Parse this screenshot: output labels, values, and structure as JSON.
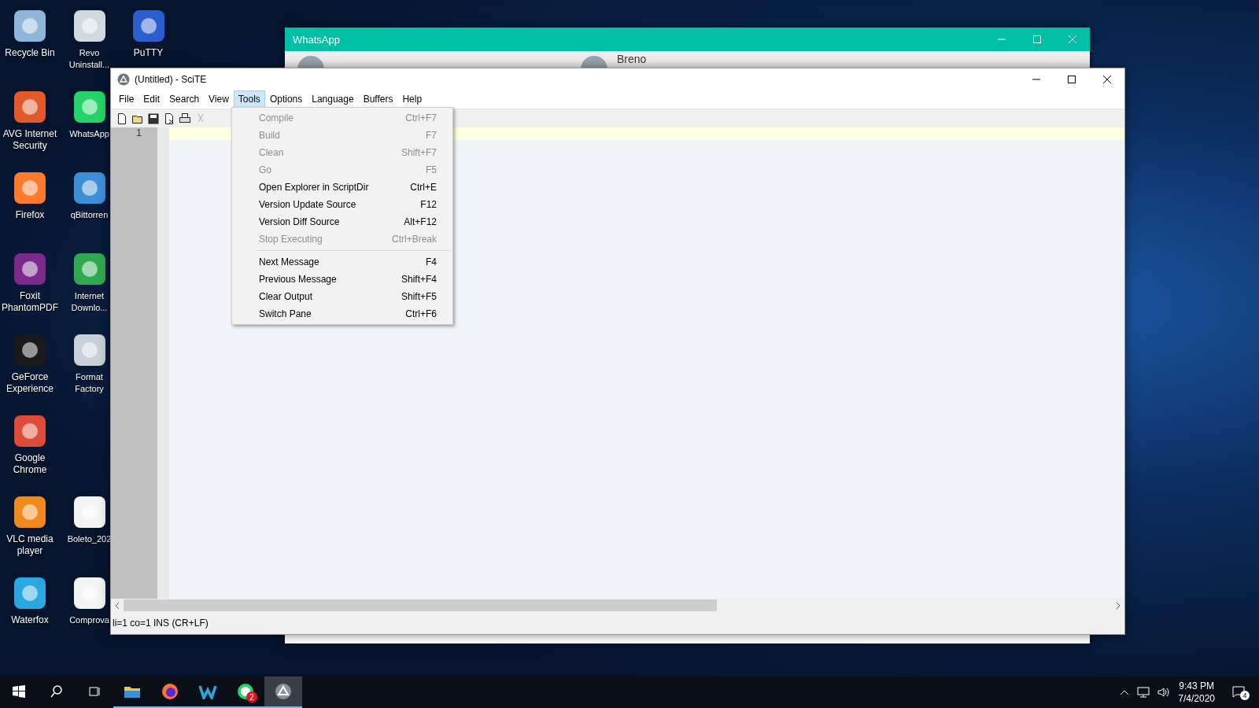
{
  "desktop": {
    "columns": [
      {
        "icons": [
          {
            "label": "Recycle Bin"
          },
          {
            "label": "AVG Internet Security"
          },
          {
            "label": "Firefox"
          },
          {
            "label": "Foxit PhantomPDF"
          },
          {
            "label": "GeForce Experience"
          },
          {
            "label": "Google Chrome"
          },
          {
            "label": "VLC media player"
          },
          {
            "label": "Waterfox"
          }
        ]
      },
      {
        "icons": [
          {
            "label": "Revo Uninstall..."
          },
          {
            "label": "WhatsApp"
          },
          {
            "label": "qBittorren"
          },
          {
            "label": "Internet Downlo..."
          },
          {
            "label": "Format Factory"
          },
          {
            "kind": "gap"
          },
          {
            "label": "Boleto_202"
          },
          {
            "label": "Comprova"
          }
        ]
      },
      {
        "icons": [
          {
            "label": "PuTTY"
          }
        ]
      }
    ]
  },
  "whatsapp": {
    "title": "WhatsApp",
    "contact": "Breno"
  },
  "scite": {
    "title": "(Untitled) - SciTE",
    "menu": [
      {
        "label": "File",
        "selected": false
      },
      {
        "label": "Edit",
        "selected": false
      },
      {
        "label": "Search",
        "selected": false
      },
      {
        "label": "View",
        "selected": false
      },
      {
        "label": "Tools",
        "selected": true
      },
      {
        "label": "Options",
        "selected": false
      },
      {
        "label": "Language",
        "selected": false
      },
      {
        "label": "Buffers",
        "selected": false
      },
      {
        "label": "Help",
        "selected": false
      }
    ],
    "line_numbers": [
      "1"
    ],
    "status": "li=1 co=1 INS (CR+LF)"
  },
  "tools_menu": {
    "sections": [
      {
        "items": [
          {
            "label": "Compile",
            "shortcut": "Ctrl+F7",
            "disabled": true
          },
          {
            "label": "Build",
            "shortcut": "F7",
            "disabled": true
          },
          {
            "label": "Clean",
            "shortcut": "Shift+F7",
            "disabled": true
          },
          {
            "label": "Go",
            "shortcut": "F5",
            "disabled": true
          },
          {
            "label": "Open Explorer in ScriptDir",
            "shortcut": "Ctrl+E",
            "disabled": false
          },
          {
            "label": "Version Update Source",
            "shortcut": "F12",
            "disabled": false
          },
          {
            "label": "Version Diff Source",
            "shortcut": "Alt+F12",
            "disabled": false
          },
          {
            "label": "Stop Executing",
            "shortcut": "Ctrl+Break",
            "disabled": true
          }
        ]
      },
      {
        "items": [
          {
            "label": "Next Message",
            "shortcut": "F4",
            "disabled": false
          },
          {
            "label": "Previous Message",
            "shortcut": "Shift+F4",
            "disabled": false
          },
          {
            "label": "Clear Output",
            "shortcut": "Shift+F5",
            "disabled": false
          },
          {
            "label": "Switch Pane",
            "shortcut": "Ctrl+F6",
            "disabled": false
          }
        ]
      }
    ]
  },
  "taskbar": {
    "apps": [
      {
        "open": true,
        "selected": false
      },
      {
        "open": true,
        "selected": false
      },
      {
        "open": true,
        "selected": false
      },
      {
        "open": true,
        "selected": false,
        "badge": "2"
      },
      {
        "open": true,
        "selected": true
      }
    ],
    "time": "9:43 PM",
    "date": "7/4/2020",
    "notifications": "4"
  }
}
